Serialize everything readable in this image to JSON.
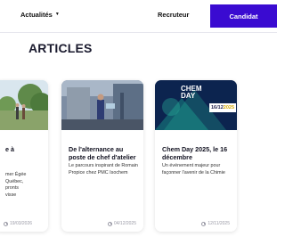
{
  "nav": {
    "actualites": "Actualités",
    "recruteur": "Recruteur",
    "candidat": "Candidat"
  },
  "section": {
    "title": "ARTICLES"
  },
  "cards": [
    {
      "title_partial": "e à",
      "desc_partial": [
        "mer Égée",
        "Québec,",
        "pronts",
        "visse"
      ],
      "date": "19/03/2026"
    },
    {
      "title": "De l'alternance au poste de chef d'atelier",
      "desc": "Le parcours inspirant de Romain Propice chez PMC Isochem",
      "date": "04/12/2025"
    },
    {
      "title": "Chem Day 2025, le 16 décembre",
      "desc": "Un événement majeur pour façonner l'avenir de la Chimie",
      "date": "12/11/2025",
      "image_logo": [
        "CHEM",
        "DAY"
      ],
      "image_badge_date": "16/12",
      "image_badge_year": "2025"
    }
  ],
  "colors": {
    "accent": "#3a0bd1"
  }
}
